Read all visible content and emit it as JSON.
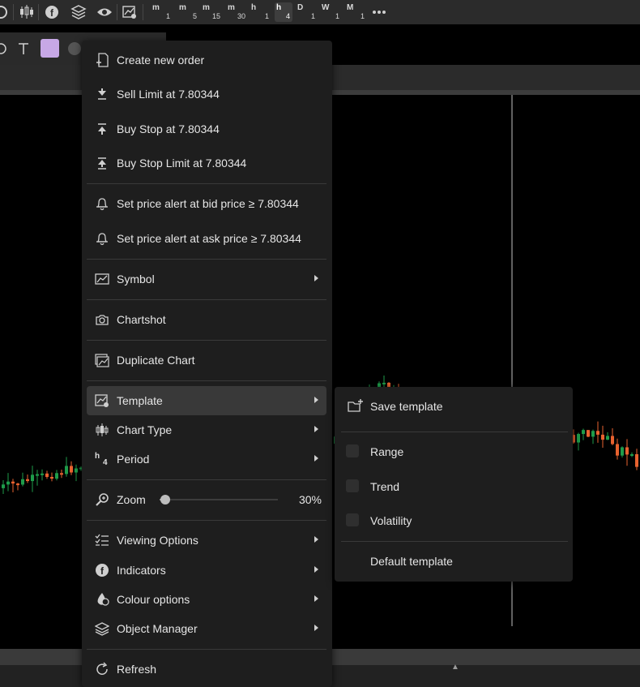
{
  "periods": [
    {
      "unit": "m",
      "num": "1"
    },
    {
      "unit": "m",
      "num": "5"
    },
    {
      "unit": "m",
      "num": "15"
    },
    {
      "unit": "m",
      "num": "30"
    },
    {
      "unit": "h",
      "num": "1"
    },
    {
      "unit": "h",
      "num": "4",
      "active": true
    },
    {
      "unit": "D",
      "num": "1"
    },
    {
      "unit": "W",
      "num": "1"
    },
    {
      "unit": "M",
      "num": "1"
    }
  ],
  "colors": {
    "bullish": "#1e9c4a",
    "bearish": "#e8622f",
    "swatch": "#c7a8e6"
  },
  "menu": {
    "order_section": [
      {
        "label": "Create new order",
        "icon": "new-order-icon"
      },
      {
        "label": "Sell Limit at 7.80344",
        "icon": "sell-limit-icon"
      },
      {
        "label": "Buy Stop at 7.80344",
        "icon": "buy-stop-icon"
      },
      {
        "label": "Buy Stop Limit at 7.80344",
        "icon": "buy-stop-limit-icon"
      }
    ],
    "alert_section": [
      {
        "label": "Set price alert at bid price ≥ 7.80344",
        "icon": "bell-icon"
      },
      {
        "label": "Set price alert at ask price ≥ 7.80344",
        "icon": "bell-icon"
      }
    ],
    "symbol": {
      "label": "Symbol",
      "icon": "symbol-chart-icon"
    },
    "chartshot": {
      "label": "Chartshot",
      "icon": "camera-icon"
    },
    "duplicate": {
      "label": "Duplicate Chart",
      "icon": "duplicate-chart-icon"
    },
    "chart_section": [
      {
        "label": "Template",
        "icon": "template-icon"
      },
      {
        "label": "Chart Type",
        "icon": "candlestick-icon"
      },
      {
        "label": "Period",
        "icon": "period-h4-icon",
        "icon_text_unit": "h",
        "icon_text_num": "4"
      }
    ],
    "zoom": {
      "label": "Zoom",
      "value_text": "30%",
      "value": 0.3,
      "icon": "zoom-in-icon"
    },
    "options_section": [
      {
        "label": "Viewing Options",
        "icon": "viewing-options-icon"
      },
      {
        "label": "Indicators",
        "icon": "indicators-icon"
      },
      {
        "label": "Colour options",
        "icon": "colour-options-icon"
      },
      {
        "label": "Object Manager",
        "icon": "layers-icon"
      }
    ],
    "refresh": {
      "label": "Refresh",
      "icon": "refresh-icon"
    }
  },
  "template_submenu": {
    "save": {
      "label": "Save template",
      "icon": "save-folder-icon"
    },
    "templates": [
      {
        "label": "Range",
        "checked": false
      },
      {
        "label": "Trend",
        "checked": false
      },
      {
        "label": "Volatility",
        "checked": false
      }
    ],
    "default": {
      "label": "Default template"
    }
  }
}
